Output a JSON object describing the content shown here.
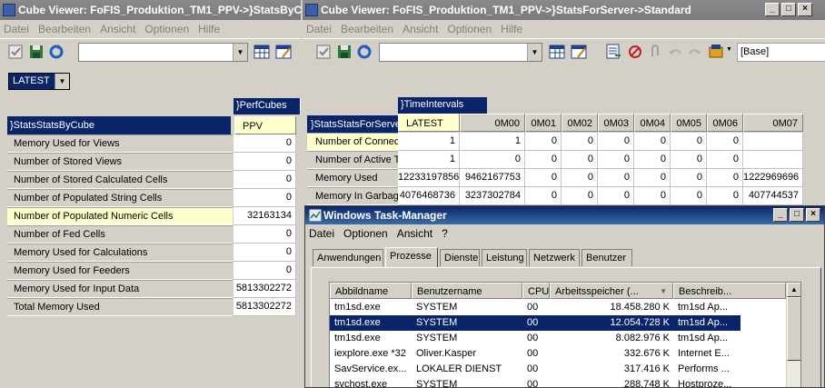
{
  "cube_viewer_left": {
    "title": "Cube Viewer: FoFIS_Produktion_TM1_PPV->}StatsByC",
    "menu": [
      "Datei",
      "Bearbeiten",
      "Ansicht",
      "Optionen",
      "Hilfe"
    ],
    "title_selector": "LATEST",
    "column_dimension": "}PerfCubes",
    "row_dimension": "}StatsStatsByCube",
    "column_header": "PPV",
    "rows": [
      {
        "label": "Memory Used for Views",
        "value": "0"
      },
      {
        "label": "Number of Stored Views",
        "value": "0"
      },
      {
        "label": "Number of Stored Calculated Cells",
        "value": "0"
      },
      {
        "label": "Number of Populated String Cells",
        "value": "0"
      },
      {
        "label": "Number of Populated Numeric Cells",
        "value": "32163134"
      },
      {
        "label": "Number of Fed Cells",
        "value": "0"
      },
      {
        "label": "Memory Used for Calculations",
        "value": "0"
      },
      {
        "label": "Memory Used for Feeders",
        "value": "0"
      },
      {
        "label": "Memory Used for Input Data",
        "value": "5813302272"
      },
      {
        "label": "Total Memory Used",
        "value": "5813302272"
      }
    ]
  },
  "cube_viewer_right": {
    "title": "Cube Viewer: FoFIS_Produktion_TM1_PPV->}StatsForServer->Standard",
    "menu": [
      "Datei",
      "Bearbeiten",
      "Ansicht",
      "Optionen",
      "Hilfe"
    ],
    "subset_box": "[Base]",
    "column_dimension": "}TimeIntervals",
    "row_dimension": "}StatsStatsForServe",
    "columns": [
      "LATEST",
      "0M00",
      "0M01",
      "0M02",
      "0M03",
      "0M04",
      "0M05",
      "0M06",
      "0M07"
    ],
    "rows": [
      {
        "label": "Number of Connec",
        "values": [
          "1",
          "1",
          "0",
          "0",
          "0",
          "0",
          "0",
          "0",
          ""
        ]
      },
      {
        "label": "Number of Active T",
        "values": [
          "1",
          "0",
          "0",
          "0",
          "0",
          "0",
          "0",
          "0",
          ""
        ]
      },
      {
        "label": "Memory Used",
        "values": [
          "12233197856",
          "9462167753",
          "0",
          "0",
          "0",
          "0",
          "0",
          "0",
          "1222969696"
        ]
      },
      {
        "label": "Memory In Garbag",
        "values": [
          "4076468736",
          "3237302784",
          "0",
          "0",
          "0",
          "0",
          "0",
          "0",
          "407744537"
        ]
      }
    ]
  },
  "task_manager": {
    "title": "Windows Task-Manager",
    "menu": [
      "Datei",
      "Optionen",
      "Ansicht",
      "?"
    ],
    "tabs": [
      "Anwendungen",
      "Prozesse",
      "Dienste",
      "Leistung",
      "Netzwerk",
      "Benutzer"
    ],
    "selected_tab": "Prozesse",
    "columns": [
      "Abbildname",
      "Benutzername",
      "CPU",
      "Arbeitsspeicher (...",
      "Beschreib..."
    ],
    "processes": [
      {
        "name": "tm1sd.exe",
        "user": "SYSTEM",
        "cpu": "00",
        "mem": "18.458.280 K",
        "desc": "tm1sd Ap..."
      },
      {
        "name": "tm1sd.exe",
        "user": "SYSTEM",
        "cpu": "00",
        "mem": "12.054.728 K",
        "desc": "tm1sd Ap...",
        "selected": true
      },
      {
        "name": "tm1sd.exe",
        "user": "SYSTEM",
        "cpu": "00",
        "mem": "8.082.976 K",
        "desc": "tm1sd Ap..."
      },
      {
        "name": "iexplore.exe *32",
        "user": "Oliver.Kasper",
        "cpu": "00",
        "mem": "332.676 K",
        "desc": "Internet E..."
      },
      {
        "name": "SavService.ex...",
        "user": "LOKALER DIENST",
        "cpu": "00",
        "mem": "317.416 K",
        "desc": "Performs ..."
      },
      {
        "name": "svchost.exe",
        "user": "SYSTEM",
        "cpu": "00",
        "mem": "288.748 K",
        "desc": "Hostproze..."
      }
    ]
  },
  "colors": {
    "navy": "#0a246a",
    "highlight": "#ffffcc",
    "inactive_title": "#808080"
  }
}
